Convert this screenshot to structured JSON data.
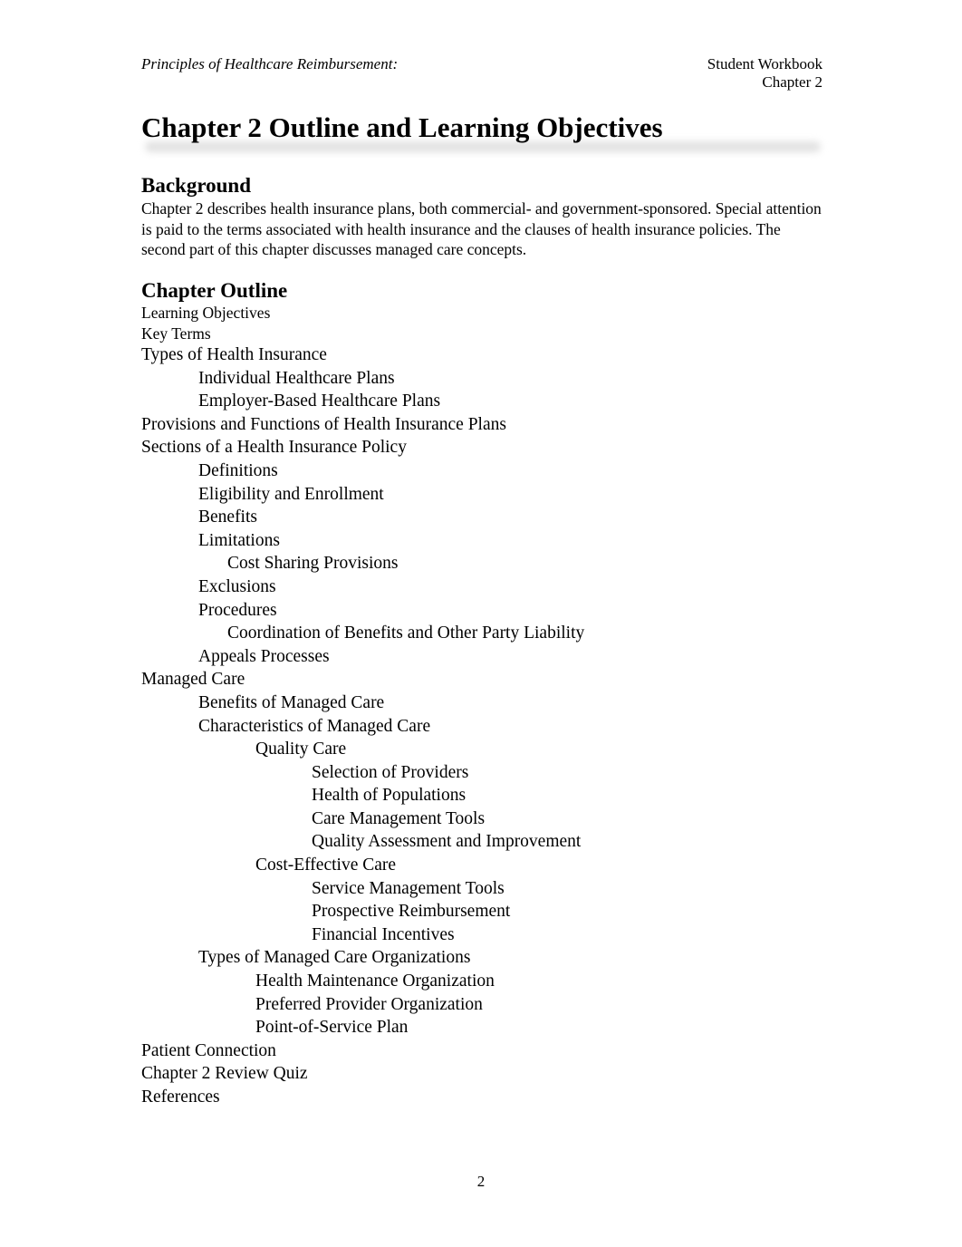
{
  "header": {
    "left": "Principles of Healthcare Reimbursement:",
    "right_line1": "Student Workbook",
    "right_line2": "Chapter 2"
  },
  "title": "Chapter 2 Outline and Learning Objectives",
  "background": {
    "heading": "Background",
    "text": "Chapter 2 describes health insurance plans, both commercial- and government-sponsored. Special attention is paid to the terms associated with health insurance and the clauses of health insurance policies. The second part of this chapter discusses managed care concepts."
  },
  "outline": {
    "heading": "Chapter Outline",
    "items": [
      {
        "text": "Learning Objectives",
        "level": 0
      },
      {
        "text": "Key Terms",
        "level": 0
      },
      {
        "text": "Types of Health Insurance",
        "level": 0
      },
      {
        "text": "Individual Healthcare Plans",
        "level": 1
      },
      {
        "text": "Employer-Based Healthcare Plans",
        "level": 1
      },
      {
        "text": "Provisions and Functions of Health Insurance Plans",
        "level": 0
      },
      {
        "text": "Sections of a Health Insurance Policy",
        "level": 0
      },
      {
        "text": "Definitions",
        "level": 1
      },
      {
        "text": "Eligibility and Enrollment",
        "level": 1
      },
      {
        "text": "Benefits",
        "level": 1
      },
      {
        "text": "Limitations",
        "level": 1
      },
      {
        "text": "Cost Sharing Provisions",
        "level": 1.5
      },
      {
        "text": "Exclusions",
        "level": 1
      },
      {
        "text": "Procedures",
        "level": 1
      },
      {
        "text": "Coordination of Benefits and Other Party Liability",
        "level": 1.5
      },
      {
        "text": "Appeals Processes",
        "level": 1
      },
      {
        "text": "Managed Care",
        "level": 0
      },
      {
        "text": "Benefits of Managed Care",
        "level": 1
      },
      {
        "text": "Characteristics of Managed Care",
        "level": 1
      },
      {
        "text": "Quality Care",
        "level": 2
      },
      {
        "text": "Selection of Providers",
        "level": 3
      },
      {
        "text": "Health of Populations",
        "level": 3
      },
      {
        "text": "Care Management Tools",
        "level": 3
      },
      {
        "text": "Quality Assessment and Improvement",
        "level": 3
      },
      {
        "text": "Cost-Effective Care",
        "level": 2
      },
      {
        "text": "Service Management Tools",
        "level": 3
      },
      {
        "text": "Prospective Reimbursement",
        "level": 3
      },
      {
        "text": "Financial Incentives",
        "level": 3
      },
      {
        "text": "Types of Managed Care Organizations",
        "level": 1
      },
      {
        "text": "Health Maintenance Organization",
        "level": 2
      },
      {
        "text": "Preferred Provider Organization",
        "level": 2
      },
      {
        "text": "Point-of-Service Plan",
        "level": 2
      },
      {
        "text": "Patient Connection",
        "level": 0
      },
      {
        "text": "Chapter 2 Review Quiz",
        "level": 0
      },
      {
        "text": "References",
        "level": 0
      }
    ]
  },
  "page_number": "2"
}
